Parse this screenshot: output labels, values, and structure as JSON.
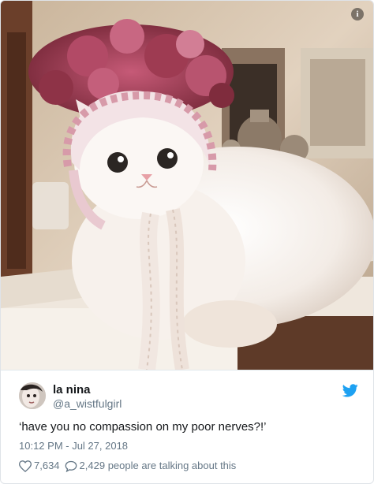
{
  "tweet": {
    "display_name": "la nina",
    "handle": "@a_wistfulgirl",
    "text": "‘have you no compassion on my poor nerves?!’",
    "timestamp": "10:12 PM - Jul 27, 2018",
    "likes": "7,634",
    "talking": "2,429 people are talking about this"
  },
  "icons": {
    "info": "info-icon",
    "brand": "bird-icon",
    "like": "heart-icon",
    "reply": "speech-bubble-icon"
  },
  "colors": {
    "brand_blue": "#1da1f2",
    "text": "#14171a",
    "muted": "#657786"
  },
  "info_glyph": "i"
}
